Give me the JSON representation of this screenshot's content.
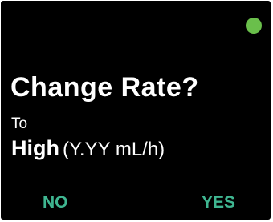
{
  "status_indicator": {
    "icon": "status-dot-icon",
    "color": "#6abf4b"
  },
  "dialog": {
    "title": "Change Rate?",
    "to_label": "To",
    "rate_name": "High",
    "rate_value": "(Y.YY mL/h)"
  },
  "softkeys": {
    "left_label": "NO",
    "right_label": "YES",
    "color": "#3fb691"
  }
}
